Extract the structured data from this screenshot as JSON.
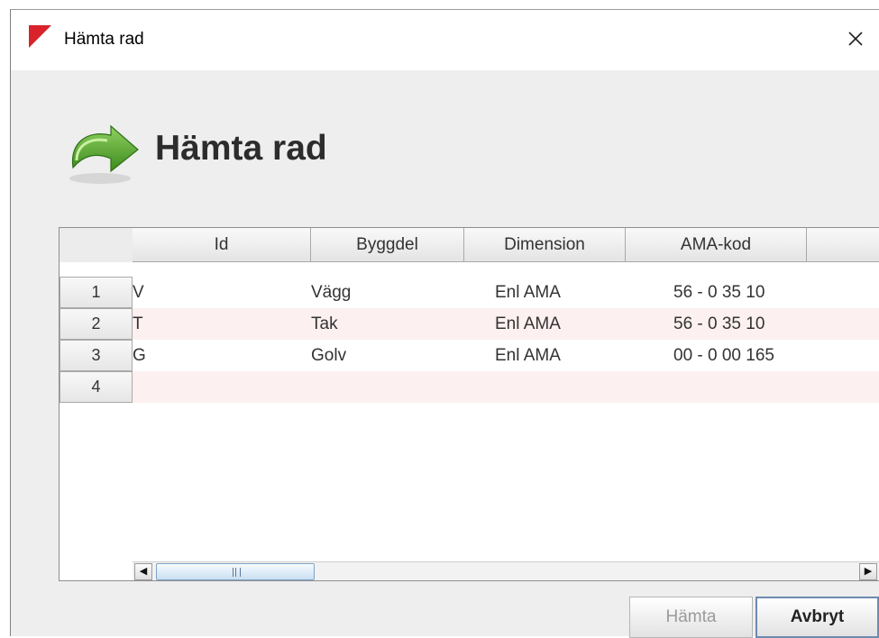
{
  "window": {
    "title": "Hämta rad",
    "close_symbol": "×",
    "app_icon": "red-triangle-icon"
  },
  "header": {
    "icon": "green-curved-arrow-icon",
    "title": "Hämta rad"
  },
  "table": {
    "columns": [
      "Id",
      "Byggdel",
      "Dimension",
      "AMA-kod"
    ],
    "rows": [
      {
        "num": "1",
        "id": "V",
        "byggdel": "Vägg",
        "dimension": "Enl AMA",
        "ama": "56 - 0 35 10"
      },
      {
        "num": "2",
        "id": "T",
        "byggdel": "Tak",
        "dimension": "Enl AMA",
        "ama": "56 - 0 35 10"
      },
      {
        "num": "3",
        "id": "G",
        "byggdel": "Golv",
        "dimension": "Enl AMA",
        "ama": "00 - 0 00 165"
      },
      {
        "num": "4",
        "id": "",
        "byggdel": "",
        "dimension": "",
        "ama": ""
      }
    ]
  },
  "scrollbar": {
    "left_arrow": "◀",
    "right_arrow": "▶"
  },
  "buttons": {
    "fetch": "Hämta",
    "cancel": "Avbryt"
  },
  "colors": {
    "stripe": "#fcf0f0",
    "arrow_green": "#5aa830",
    "title_red": "#d8232a"
  }
}
